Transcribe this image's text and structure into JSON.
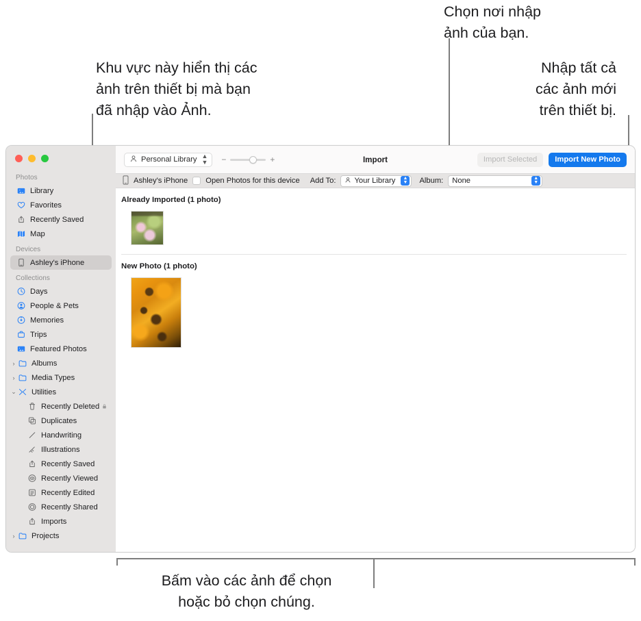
{
  "annotations": {
    "left": "Khu vực này hiển thị các\nảnh trên thiết bị mà bạn\nđã nhập vào Ảnh.",
    "top_right": "Chọn nơi nhập\nảnh của bạn.",
    "right": "Nhập tất cả\ncác ảnh mới\ntrên thiết bị.",
    "bottom": "Bấm vào các ảnh để chọn\nhoặc bỏ chọn chúng."
  },
  "window": {
    "traffic_lights": [
      "close",
      "minimize",
      "zoom"
    ],
    "colors": {
      "close": "#ff5f57",
      "minimize": "#febc2e",
      "zoom": "#28c840",
      "accent": "#1479ed",
      "sidebar_bg": "#e6e4e3",
      "icon_blue": "#2b82f6"
    }
  },
  "sidebar": {
    "sections": [
      {
        "header": "Photos",
        "items": [
          {
            "label": "Library",
            "icon": "photos-library-icon",
            "selected": false,
            "indent": false,
            "twisty": "",
            "gray": false
          },
          {
            "label": "Favorites",
            "icon": "heart-icon",
            "selected": false,
            "indent": false,
            "twisty": "",
            "gray": false
          },
          {
            "label": "Recently Saved",
            "icon": "save-arrow-icon",
            "selected": false,
            "indent": false,
            "twisty": "",
            "gray": true
          },
          {
            "label": "Map",
            "icon": "map-icon",
            "selected": false,
            "indent": false,
            "twisty": "",
            "gray": false
          }
        ]
      },
      {
        "header": "Devices",
        "items": [
          {
            "label": "Ashley's iPhone",
            "icon": "iphone-icon",
            "selected": true,
            "indent": false,
            "twisty": "",
            "gray": true
          }
        ]
      },
      {
        "header": "Collections",
        "items": [
          {
            "label": "Days",
            "icon": "clock-icon",
            "selected": false,
            "indent": false,
            "twisty": "",
            "gray": false
          },
          {
            "label": "People & Pets",
            "icon": "person-circle-icon",
            "selected": false,
            "indent": false,
            "twisty": "",
            "gray": false
          },
          {
            "label": "Memories",
            "icon": "memories-icon",
            "selected": false,
            "indent": false,
            "twisty": "",
            "gray": false
          },
          {
            "label": "Trips",
            "icon": "suitcase-icon",
            "selected": false,
            "indent": false,
            "twisty": "",
            "gray": false
          },
          {
            "label": "Featured Photos",
            "icon": "featured-photo-icon",
            "selected": false,
            "indent": false,
            "twisty": "",
            "gray": false
          },
          {
            "label": "Albums",
            "icon": "folder-icon",
            "selected": false,
            "indent": false,
            "twisty": "collapsed",
            "gray": false
          },
          {
            "label": "Media Types",
            "icon": "folder-icon",
            "selected": false,
            "indent": false,
            "twisty": "collapsed",
            "gray": false
          },
          {
            "label": "Utilities",
            "icon": "tools-icon",
            "selected": false,
            "indent": false,
            "twisty": "expanded",
            "gray": false
          },
          {
            "label": "Recently Deleted",
            "icon": "trash-icon",
            "selected": false,
            "indent": true,
            "twisty": "",
            "gray": true,
            "badge": "lock-icon"
          },
          {
            "label": "Duplicates",
            "icon": "duplicate-icon",
            "selected": false,
            "indent": true,
            "twisty": "",
            "gray": true
          },
          {
            "label": "Handwriting",
            "icon": "pen-stroke-icon",
            "selected": false,
            "indent": true,
            "twisty": "",
            "gray": true
          },
          {
            "label": "Illustrations",
            "icon": "illustration-icon",
            "selected": false,
            "indent": true,
            "twisty": "",
            "gray": true
          },
          {
            "label": "Recently Saved",
            "icon": "save-arrow-icon",
            "selected": false,
            "indent": true,
            "twisty": "",
            "gray": true
          },
          {
            "label": "Recently Viewed",
            "icon": "eye-circle-icon",
            "selected": false,
            "indent": true,
            "twisty": "",
            "gray": true
          },
          {
            "label": "Recently Edited",
            "icon": "edited-icon",
            "selected": false,
            "indent": true,
            "twisty": "",
            "gray": true
          },
          {
            "label": "Recently Shared",
            "icon": "shared-icon",
            "selected": false,
            "indent": true,
            "twisty": "",
            "gray": true
          },
          {
            "label": "Imports",
            "icon": "import-icon",
            "selected": false,
            "indent": true,
            "twisty": "",
            "gray": true
          },
          {
            "label": "Projects",
            "icon": "folder-icon",
            "selected": false,
            "indent": false,
            "twisty": "collapsed",
            "gray": false
          }
        ]
      }
    ]
  },
  "toolbar": {
    "library_selector": "Personal Library",
    "library_icon": "person-icon",
    "zoom_out_symbol": "−",
    "zoom_in_symbol": "+",
    "zoom_value": 55,
    "title": "Import",
    "import_selected_label": "Import Selected",
    "import_selected_disabled": true,
    "import_new_label": "Import New Photo"
  },
  "subbar": {
    "device_icon": "iphone-icon",
    "device_name": "Ashley's iPhone",
    "open_photos_checkbox": false,
    "open_photos_label": "Open Photos for this device",
    "add_to_label": "Add To:",
    "add_to_value": "Your Library",
    "add_to_icon": "person-icon",
    "album_label": "Album:",
    "album_value": "None"
  },
  "content": {
    "sections": [
      {
        "title": "Already Imported (1 photo)",
        "photo_class": "ph-pink",
        "thumb_size": "t1"
      },
      {
        "title": "New Photo (1 photo)",
        "photo_class": "ph-orange",
        "thumb_size": "t2"
      }
    ]
  }
}
